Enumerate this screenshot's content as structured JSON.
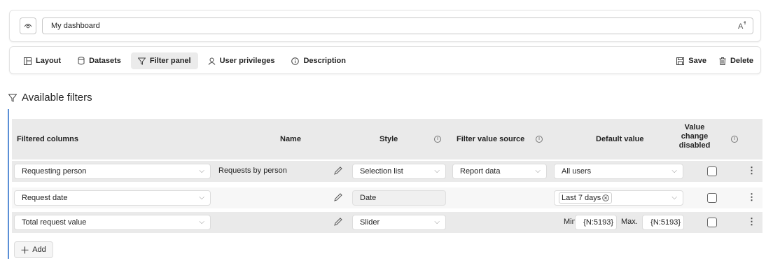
{
  "dashboard": {
    "title": "My dashboard"
  },
  "tabs": [
    {
      "label": "Layout",
      "icon": "layout-icon"
    },
    {
      "label": "Datasets",
      "icon": "database-icon"
    },
    {
      "label": "Filter panel",
      "icon": "filter-icon",
      "active": true
    },
    {
      "label": "User privileges",
      "icon": "person-icon"
    },
    {
      "label": "Description",
      "icon": "info-icon"
    }
  ],
  "actions": {
    "save": "Save",
    "delete": "Delete"
  },
  "section": {
    "title": "Available filters"
  },
  "columns": {
    "filtered": "Filtered columns",
    "name": "Name",
    "style": "Style",
    "source": "Filter value source",
    "default": "Default value",
    "value_change": [
      "Value",
      "change",
      "disabled"
    ]
  },
  "rows": [
    {
      "column": "Requesting person",
      "name": "Requests by person",
      "style": "Selection list",
      "source": "Report data",
      "default": "All users"
    },
    {
      "column": "Request date",
      "name": "",
      "style": "Date",
      "source": "",
      "default": "Last 7 days"
    },
    {
      "column": "Total request value",
      "name": "",
      "style": "Slider",
      "source": "",
      "min_label": "Min.",
      "min_value": "{N:5193}",
      "max_label": "Max.",
      "max_value": "{N:5193}"
    }
  ],
  "add": {
    "label": "Add"
  },
  "colors": {
    "accent": "#5b8fd6",
    "header_bg": "#eaeaea"
  }
}
